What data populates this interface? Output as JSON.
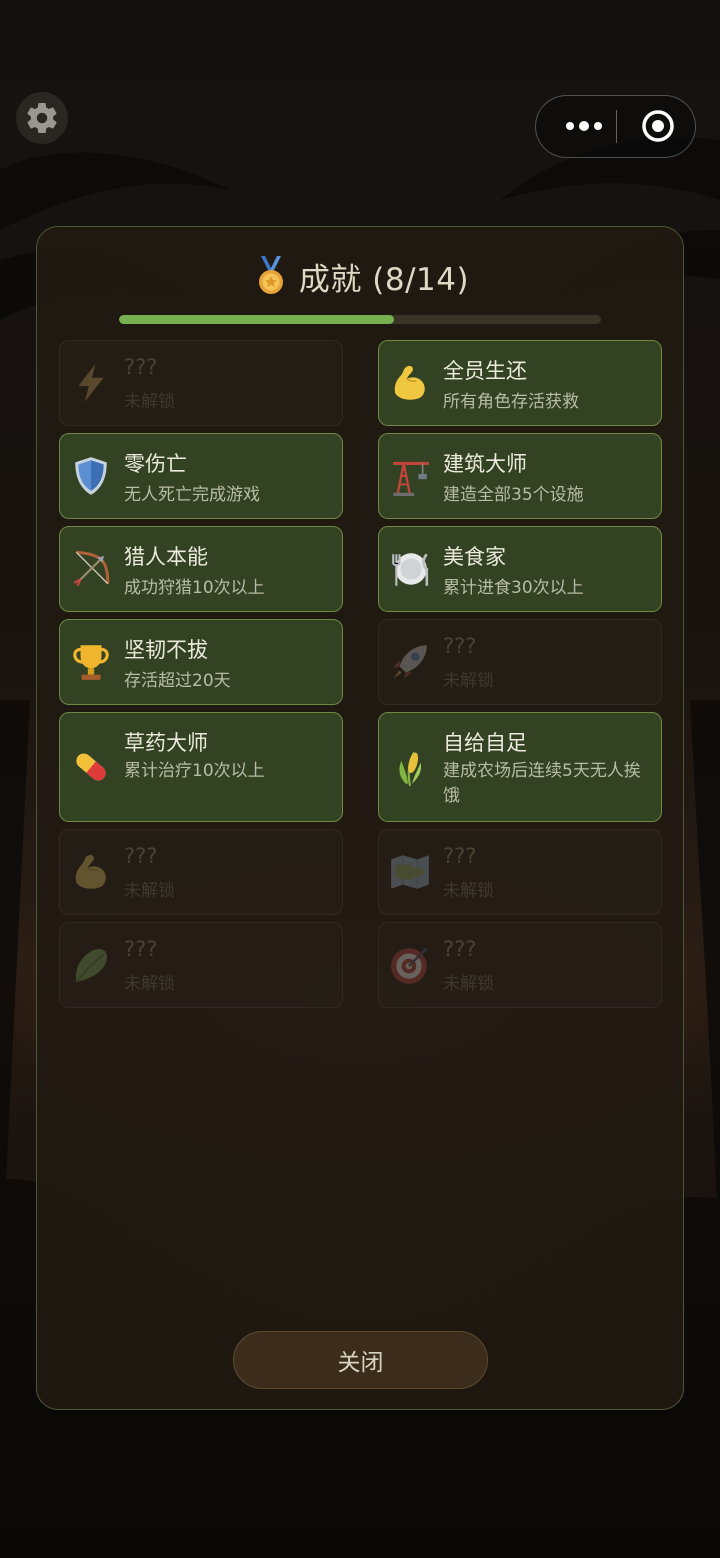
{
  "header": {
    "settings_icon": "gear-icon",
    "more_icon": "more-dots-icon",
    "exit_icon": "target-circle-icon"
  },
  "dialog": {
    "title": "成就 (8/14)",
    "title_icon": "medal-icon",
    "progress": {
      "unlocked": 8,
      "total": 14,
      "fraction": 0.5714
    },
    "achievements": [
      {
        "name": "???",
        "desc": "未解锁",
        "icon": "lightning-icon",
        "unlocked": false
      },
      {
        "name": "全员生还",
        "desc": "所有角色存活获救",
        "icon": "flexed-bicep-icon",
        "unlocked": true
      },
      {
        "name": "零伤亡",
        "desc": "无人死亡完成游戏",
        "icon": "shield-icon",
        "unlocked": true
      },
      {
        "name": "建筑大师",
        "desc": "建造全部35个设施",
        "icon": "crane-icon",
        "unlocked": true
      },
      {
        "name": "猎人本能",
        "desc": "成功狩猎10次以上",
        "icon": "bow-arrow-icon",
        "unlocked": true
      },
      {
        "name": "美食家",
        "desc": "累计进食30次以上",
        "icon": "plate-cutlery-icon",
        "unlocked": true
      },
      {
        "name": "坚韧不拔",
        "desc": "存活超过20天",
        "icon": "trophy-icon",
        "unlocked": true
      },
      {
        "name": "???",
        "desc": "未解锁",
        "icon": "rocket-icon",
        "unlocked": false
      },
      {
        "name": "草药大师",
        "desc": "累计治疗10次以上",
        "icon": "pill-icon",
        "unlocked": true
      },
      {
        "name": "自给自足",
        "desc": "建成农场后连续5天无人挨饿",
        "icon": "corn-icon",
        "unlocked": true
      },
      {
        "name": "???",
        "desc": "未解锁",
        "icon": "flexed-bicep-icon",
        "unlocked": false
      },
      {
        "name": "???",
        "desc": "未解锁",
        "icon": "map-icon",
        "unlocked": false
      },
      {
        "name": "???",
        "desc": "未解锁",
        "icon": "leafy-green-icon",
        "unlocked": false
      },
      {
        "name": "???",
        "desc": "未解锁",
        "icon": "dart-target-icon",
        "unlocked": false
      }
    ],
    "close_label": "关闭"
  },
  "colors": {
    "panel_border": "#4c5a33",
    "card_unlocked_bg": "#334223",
    "card_unlocked_border": "#6d8a45",
    "progress_fill": "#76b050",
    "close_button_bg": "#3b2c1b"
  }
}
